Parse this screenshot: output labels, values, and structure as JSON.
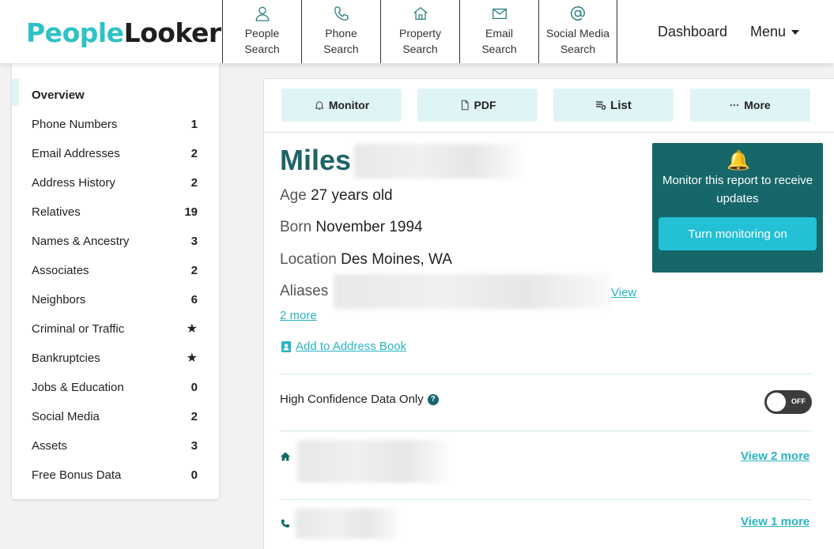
{
  "brand": {
    "part1": "People",
    "part2": "Looker"
  },
  "nav": [
    {
      "line1": "People",
      "line2": "Search",
      "icon": "person-icon"
    },
    {
      "line1": "Phone",
      "line2": "Search",
      "icon": "phone-icon"
    },
    {
      "line1": "Property",
      "line2": "Search",
      "icon": "home-icon"
    },
    {
      "line1": "Email",
      "line2": "Search",
      "icon": "envelope-icon"
    },
    {
      "line1": "Social Media",
      "line2": "Search",
      "icon": "at-sign-icon"
    }
  ],
  "header": {
    "dashboard": "Dashboard",
    "menu": "Menu"
  },
  "sidebar": {
    "items": [
      {
        "label": "Overview",
        "count": ""
      },
      {
        "label": "Phone Numbers",
        "count": "1"
      },
      {
        "label": "Email Addresses",
        "count": "2"
      },
      {
        "label": "Address History",
        "count": "2"
      },
      {
        "label": "Relatives",
        "count": "19"
      },
      {
        "label": "Names & Ancestry",
        "count": "3"
      },
      {
        "label": "Associates",
        "count": "2"
      },
      {
        "label": "Neighbors",
        "count": "6"
      },
      {
        "label": "Criminal or Traffic",
        "count": "★"
      },
      {
        "label": "Bankruptcies",
        "count": "★"
      },
      {
        "label": "Jobs & Education",
        "count": "0"
      },
      {
        "label": "Social Media",
        "count": "2"
      },
      {
        "label": "Assets",
        "count": "3"
      },
      {
        "label": "Free Bonus Data",
        "count": "0"
      }
    ]
  },
  "actions": {
    "monitor": "Monitor",
    "pdf": "PDF",
    "list": "List",
    "more": "More",
    "more_glyph": "···"
  },
  "profile": {
    "first_name": "Miles",
    "age_label": "Age",
    "age_value": "27 years old",
    "born_label": "Born",
    "born_value": "November 1994",
    "location_label": "Location",
    "location_value": "Des Moines, WA",
    "aliases_label": "Aliases",
    "aliases_view": "View",
    "aliases_more": "2 more",
    "add_address_book": "Add to Address Book"
  },
  "monitor_card": {
    "message": "Monitor this report to receive updates",
    "button": "Turn monitoring on"
  },
  "high_confidence": {
    "label": "High Confidence Data Only",
    "help": "?",
    "toggle_state": "OFF"
  },
  "rows": {
    "address_more": "View 2 more",
    "phone_more": "View 1 more"
  },
  "colors": {
    "teal_dark": "#16676a",
    "teal_light": "#dff4f5",
    "accent": "#2ab4c2",
    "brand": "#2fc1c8"
  }
}
